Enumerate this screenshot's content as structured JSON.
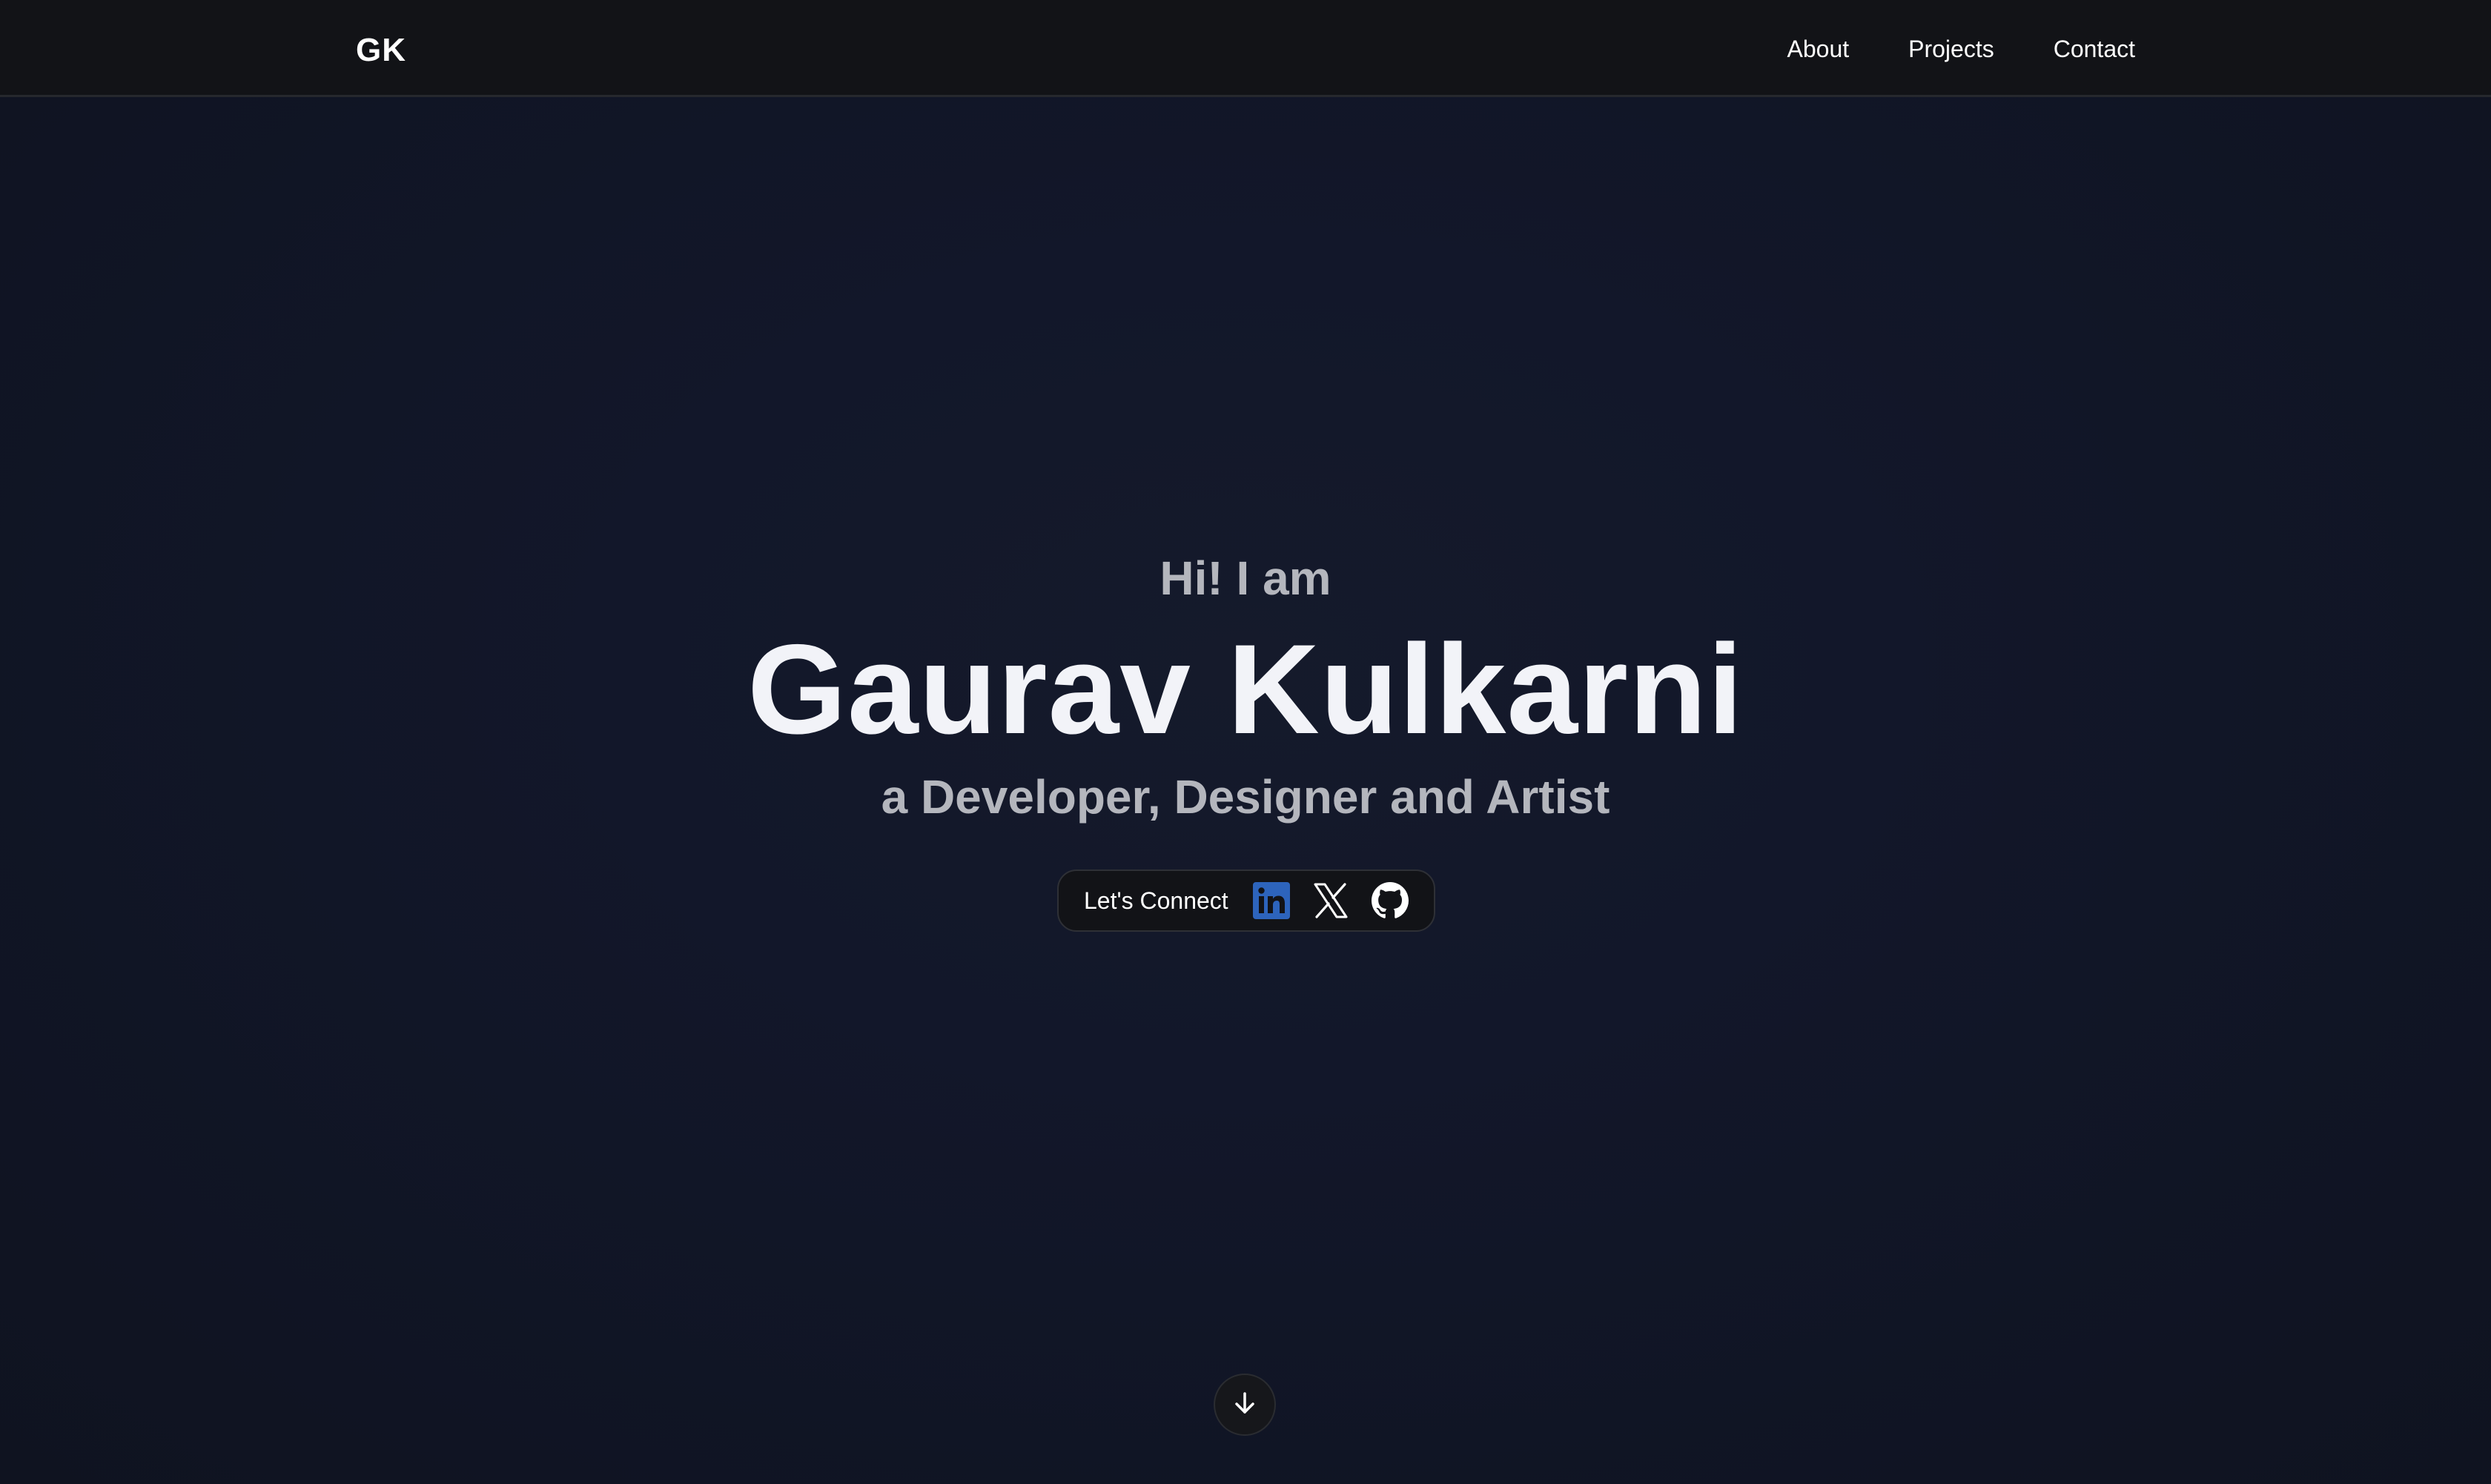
{
  "nav": {
    "logo": "GK",
    "links": [
      "About",
      "Projects",
      "Contact"
    ]
  },
  "hero": {
    "greeting": "Hi! I am",
    "name": "Gaurav Kulkarni",
    "tagline": "a Developer, Designer and Artist"
  },
  "connect": {
    "label": "Let's Connect",
    "icons": [
      "linkedin-icon",
      "x-icon",
      "github-icon"
    ]
  },
  "scroll": {
    "icon": "arrow-down-icon"
  },
  "colors": {
    "background": "#12172a",
    "navbar": "#121317",
    "linkedin": "#2d64bc",
    "text_primary": "#f2f3f8",
    "text_secondary": "#b4b6bd"
  }
}
